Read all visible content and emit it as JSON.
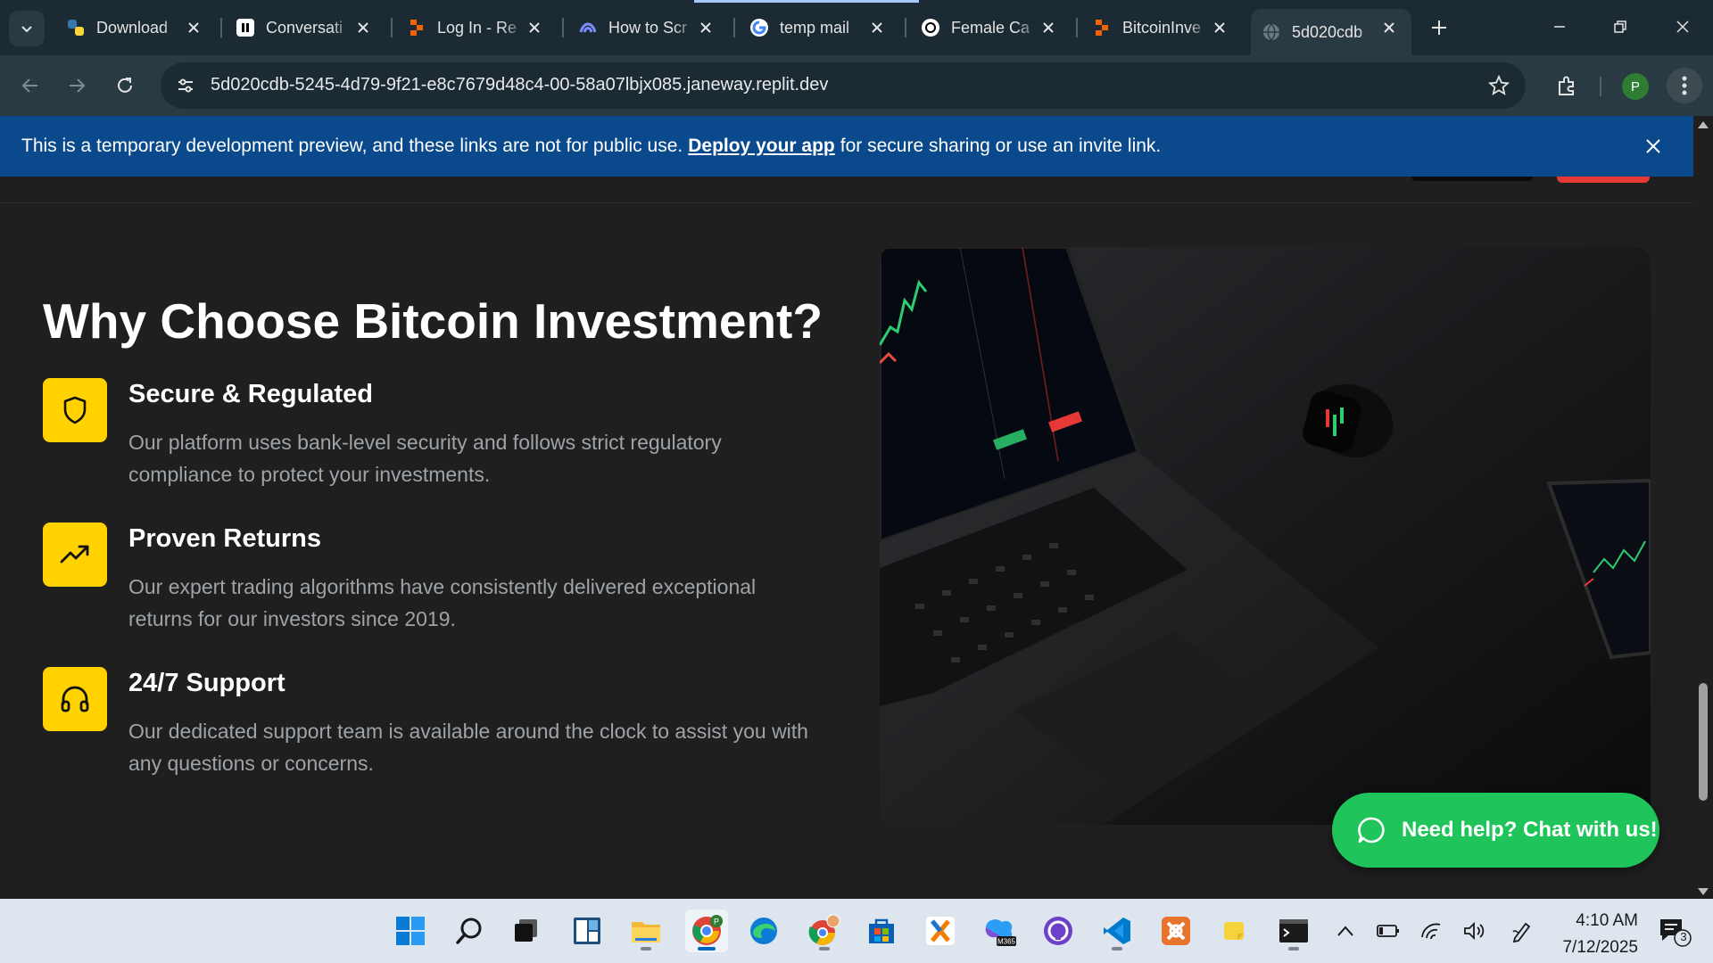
{
  "browser": {
    "tabs": [
      {
        "title": "Download",
        "icon": "python-icon"
      },
      {
        "title": "Conversati",
        "icon": "pause-app-icon"
      },
      {
        "title": "Log In - Re",
        "icon": "replit-icon"
      },
      {
        "title": "How to Scr",
        "icon": "octopus-icon"
      },
      {
        "title": "temp mail",
        "icon": "google-icon"
      },
      {
        "title": "Female Ca",
        "icon": "openai-icon"
      },
      {
        "title": "BitcoinInve",
        "icon": "replit-icon"
      },
      {
        "title": "5d020cdb",
        "icon": "globe-icon",
        "active": true
      }
    ],
    "url": "5d020cdb-5245-4d79-9f21-e8c7679d48c4-00-58a07lbjx085.janeway.replit.dev",
    "profile_initial": "P"
  },
  "banner": {
    "text_before": "This is a temporary development preview, and these links are not for public use.",
    "link": "Deploy your app",
    "text_after": "for secure sharing or use an invite link."
  },
  "section": {
    "title": "Why Choose Bitcoin Investment?",
    "features": [
      {
        "icon": "shield-icon",
        "title": "Secure & Regulated",
        "description": "Our platform uses bank-level security and follows strict regulatory compliance to protect your investments."
      },
      {
        "icon": "trending-up-icon",
        "title": "Proven Returns",
        "description": "Our expert trading algorithms have consistently delivered exceptional returns for our investors since 2019."
      },
      {
        "icon": "headphones-icon",
        "title": "24/7 Support",
        "description": "Our dedicated support team is available around the clock to assist you with any questions or concerns."
      }
    ]
  },
  "chat": {
    "label": "Need help? Chat with us!"
  },
  "taskbar": {
    "apps": [
      "windows-start-icon",
      "search-icon",
      "task-view-icon",
      "widgets-icon",
      "file-explorer-icon",
      "chrome-icon",
      "edge-icon",
      "chrome-profile-icon",
      "microsoft-store-icon",
      "xampp-like-icon",
      "m365-icon",
      "github-desktop-icon",
      "vscode-icon",
      "postman-like-icon",
      "sticky-notes-icon",
      "terminal-icon"
    ],
    "time": "4:10 AM",
    "date": "7/12/2025",
    "notification_count": "3"
  },
  "colors": {
    "accent_yellow": "#ffd200",
    "chat_green": "#1fc55a",
    "banner_blue": "#0a4a8c",
    "page_bg": "#1f1f1f"
  }
}
